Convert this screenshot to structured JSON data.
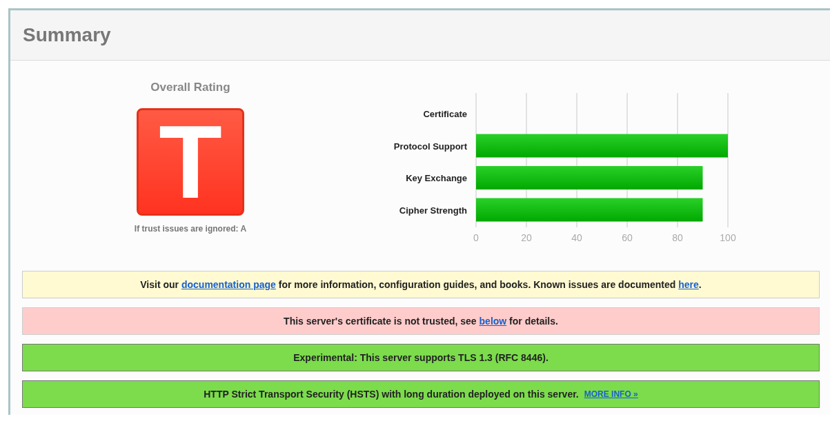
{
  "panel": {
    "title": "Summary"
  },
  "rating": {
    "heading": "Overall Rating",
    "grade": "T",
    "note": "If trust issues are ignored: A"
  },
  "chart_data": {
    "type": "bar",
    "orientation": "horizontal",
    "categories": [
      "Certificate",
      "Protocol Support",
      "Key Exchange",
      "Cipher Strength"
    ],
    "values": [
      0,
      100,
      90,
      90
    ],
    "grid": true,
    "xlim": [
      0,
      100
    ],
    "xticks": [
      0,
      20,
      40,
      60,
      80,
      100
    ]
  },
  "messages": [
    {
      "kind": "info",
      "parts": [
        {
          "text": "Visit our ",
          "link": false
        },
        {
          "text": "documentation page",
          "link": true
        },
        {
          "text": " for more information, configuration guides, and books. Known issues are documented ",
          "link": false
        },
        {
          "text": "here",
          "link": true
        },
        {
          "text": ".",
          "link": false
        }
      ]
    },
    {
      "kind": "warning",
      "parts": [
        {
          "text": "This server's certificate is not trusted, see ",
          "link": false
        },
        {
          "text": "below",
          "link": true
        },
        {
          "text": " for details.",
          "link": false
        }
      ]
    },
    {
      "kind": "good",
      "parts": [
        {
          "text": "Experimental: This server supports TLS 1.3 (RFC 8446).",
          "link": false
        }
      ]
    },
    {
      "kind": "good",
      "parts": [
        {
          "text": "HTTP Strict Transport Security (HSTS) with long duration deployed on this server.",
          "link": false
        }
      ],
      "action": "MORE INFO »"
    }
  ]
}
